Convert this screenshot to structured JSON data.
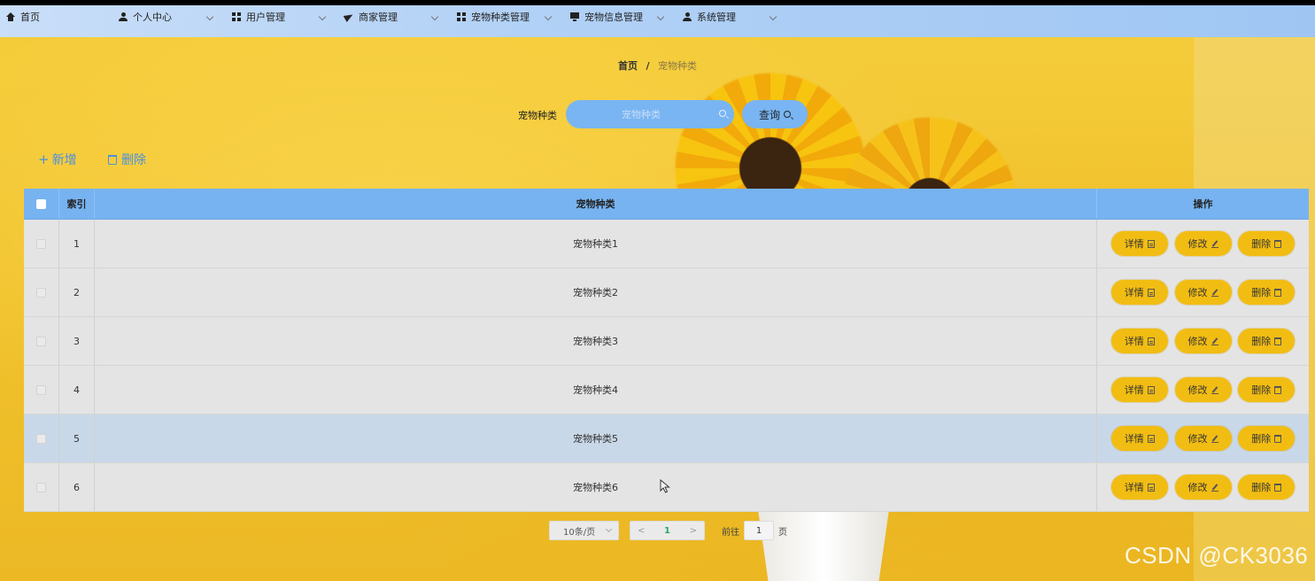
{
  "nav": {
    "items": [
      {
        "label": "首页",
        "icon": "home-icon",
        "dropdown": false
      },
      {
        "label": "个人中心",
        "icon": "user-icon",
        "dropdown": true
      },
      {
        "label": "用户管理",
        "icon": "grid-icon",
        "dropdown": true
      },
      {
        "label": "商家管理",
        "icon": "send-icon",
        "dropdown": true
      },
      {
        "label": "宠物种类管理",
        "icon": "grid-icon",
        "dropdown": true
      },
      {
        "label": "宠物信息管理",
        "icon": "monitor-icon",
        "dropdown": true
      },
      {
        "label": "系统管理",
        "icon": "user-icon",
        "dropdown": true
      }
    ]
  },
  "breadcrumb": {
    "home": "首页",
    "separator": "/",
    "current": "宠物种类"
  },
  "search": {
    "label": "宠物种类",
    "placeholder": "宠物种类",
    "value": "",
    "button_label": "查询"
  },
  "toolbar": {
    "add_label": "新增",
    "delete_label": "删除"
  },
  "table": {
    "columns": [
      "索引",
      "宠物种类",
      "操作"
    ],
    "rows": [
      {
        "index": "1",
        "type": "宠物种类1"
      },
      {
        "index": "2",
        "type": "宠物种类2"
      },
      {
        "index": "3",
        "type": "宠物种类3"
      },
      {
        "index": "4",
        "type": "宠物种类4"
      },
      {
        "index": "5",
        "type": "宠物种类5"
      },
      {
        "index": "6",
        "type": "宠物种类6"
      }
    ],
    "hovered_row": 5,
    "actions": {
      "detail": "详情",
      "edit": "修改",
      "delete": "删除"
    }
  },
  "pagination": {
    "page_size": "10条/页",
    "prev": "<",
    "current_page": "1",
    "next": ">",
    "goto_label": "前往",
    "goto_value": "1",
    "goto_suffix": "页"
  },
  "watermark": "CSDN @CK3036",
  "colors": {
    "nav_bg": "#b2d1f6",
    "accent_blue": "#79b5f2",
    "table_header": "#77b3f1",
    "action_yellow": "#f2bd12",
    "link_blue": "#4a90e2",
    "page_active": "#2aa36b",
    "background_yellow": "#f1c634"
  }
}
